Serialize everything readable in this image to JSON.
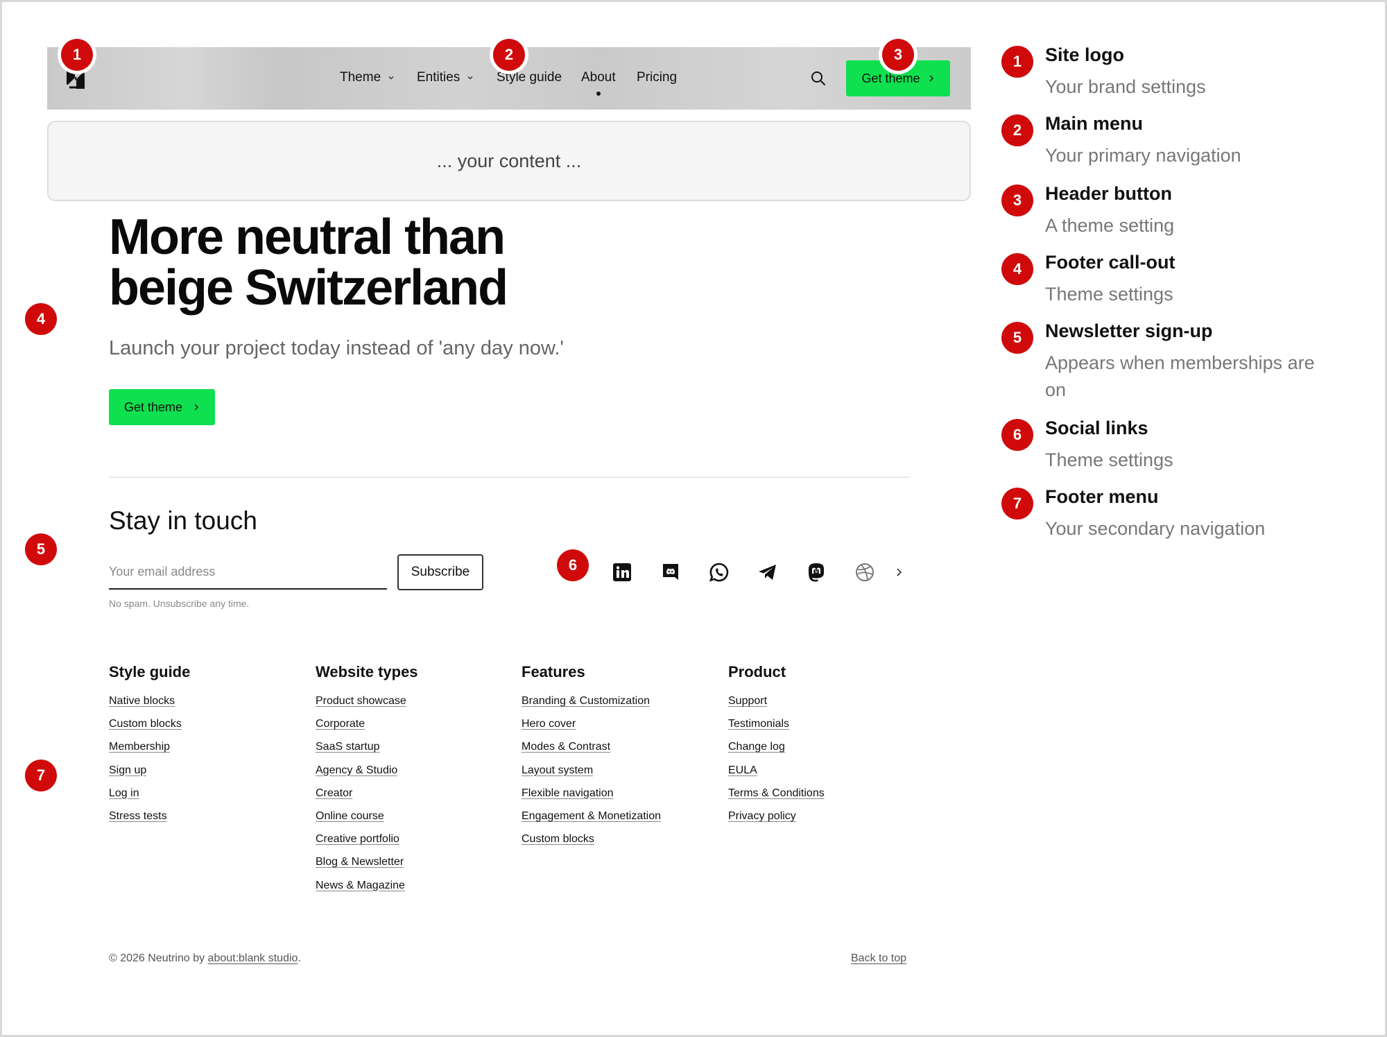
{
  "header": {
    "nav": [
      {
        "label": "Theme",
        "has_dropdown": true
      },
      {
        "label": "Entities",
        "has_dropdown": true
      },
      {
        "label": "Style guide",
        "has_dropdown": false
      },
      {
        "label": "About",
        "has_dropdown": false,
        "active": true
      },
      {
        "label": "Pricing",
        "has_dropdown": false
      }
    ],
    "cta_label": "Get theme",
    "icons": {
      "logo": "neutrino-logo-icon",
      "search": "search-icon"
    }
  },
  "content_placeholder": "... your content ...",
  "hero": {
    "title_line1": "More neutral than",
    "title_line2": "beige Switzerland",
    "subtitle": "Launch your project today instead of 'any day now.'",
    "cta_label": "Get theme"
  },
  "newsletter": {
    "heading": "Stay in touch",
    "email_placeholder": "Your email address",
    "subscribe_label": "Subscribe",
    "note": "No spam. Unsubscribe any time."
  },
  "social": [
    "linkedin-icon",
    "discord-icon",
    "whatsapp-icon",
    "telegram-icon",
    "mastodon-icon",
    "dribbble-icon",
    "chevron-right-icon"
  ],
  "footer": {
    "columns": [
      {
        "title": "Style guide",
        "links": [
          "Native blocks",
          "Custom blocks",
          "Membership",
          "Sign up",
          "Log in",
          "Stress tests"
        ]
      },
      {
        "title": "Website types",
        "links": [
          "Product showcase",
          "Corporate",
          "SaaS startup",
          "Agency & Studio",
          "Creator",
          "Online course",
          "Creative portfolio",
          "Blog & Newsletter",
          "News & Magazine"
        ]
      },
      {
        "title": "Features",
        "links": [
          "Branding & Customization",
          "Hero cover",
          "Modes & Contrast",
          "Layout system",
          "Flexible navigation",
          "Engagement & Monetization",
          "Custom blocks"
        ]
      },
      {
        "title": "Product",
        "links": [
          "Support",
          "Testimonials",
          "Change log",
          "EULA",
          "Terms & Conditions",
          "Privacy policy"
        ]
      }
    ],
    "copyright_prefix": "© 2026 Neutrino by",
    "copyright_link": "about:blank studio",
    "copyright_suffix": ".",
    "back_to_top": "Back to top"
  },
  "legend": [
    {
      "num": "1",
      "title": "Site logo",
      "desc": "Your brand settings"
    },
    {
      "num": "2",
      "title": "Main menu",
      "desc": "Your primary navigation"
    },
    {
      "num": "3",
      "title": "Header button",
      "desc": "A theme setting"
    },
    {
      "num": "4",
      "title": "Footer call-out",
      "desc": "Theme settings"
    },
    {
      "num": "5",
      "title": "Newsletter sign-up",
      "desc": "Appears when memberships are on"
    },
    {
      "num": "6",
      "title": "Social links",
      "desc": "Theme settings"
    },
    {
      "num": "7",
      "title": "Footer menu",
      "desc": "Your secondary navigation"
    }
  ],
  "badges": [
    "1",
    "2",
    "3",
    "4",
    "5",
    "6",
    "7"
  ],
  "colors": {
    "accent": "#0fe04f",
    "badge": "#d00a0a"
  }
}
